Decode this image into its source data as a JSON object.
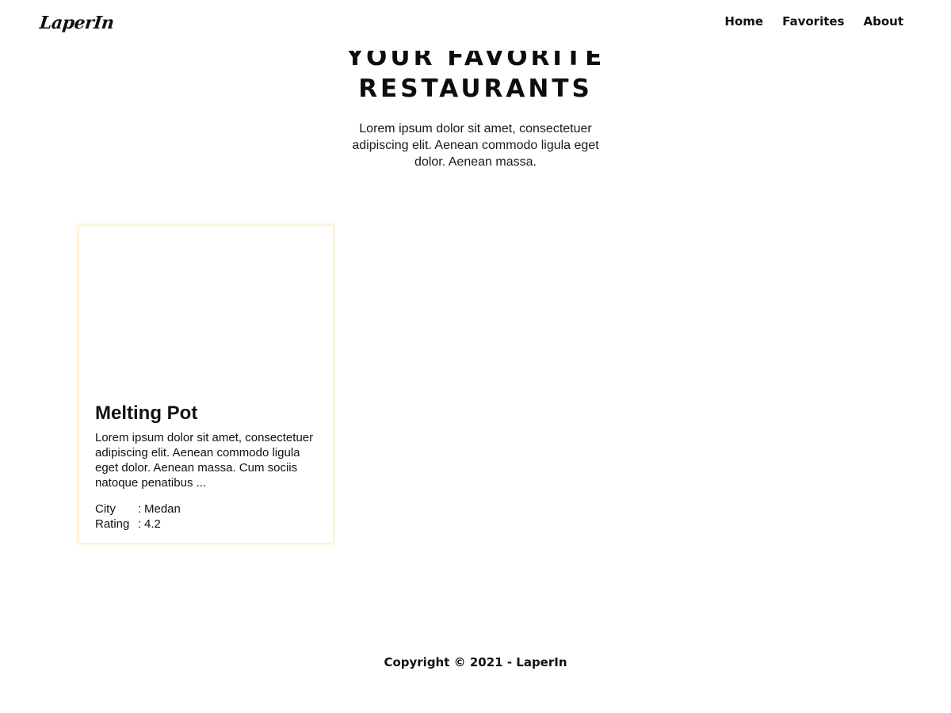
{
  "header": {
    "logo": "LaperIn",
    "nav": [
      {
        "label": "Home"
      },
      {
        "label": "Favorites"
      },
      {
        "label": "About"
      }
    ]
  },
  "hero": {
    "title_line1": "YOUR FAVORITE",
    "title_line2": "RESTAURANTS",
    "description": "Lorem ipsum dolor sit amet, consectetuer adipiscing elit. Aenean commodo ligula eget dolor. Aenean massa."
  },
  "restaurants": [
    {
      "name": "Melting Pot",
      "description": "Lorem ipsum dolor sit amet, consectetuer adipiscing elit. Aenean commodo ligula eget dolor. Aenean massa. Cum sociis natoque penatibus ...",
      "city_label": "City",
      "city": "Medan",
      "rating_label": "Rating",
      "rating": "4.2"
    }
  ],
  "footer": {
    "copyright": "Copyright © 2021 - LaperIn"
  },
  "colors": {
    "card_shadow": "#ffc85a",
    "text": "#111111",
    "background": "#ffffff"
  }
}
